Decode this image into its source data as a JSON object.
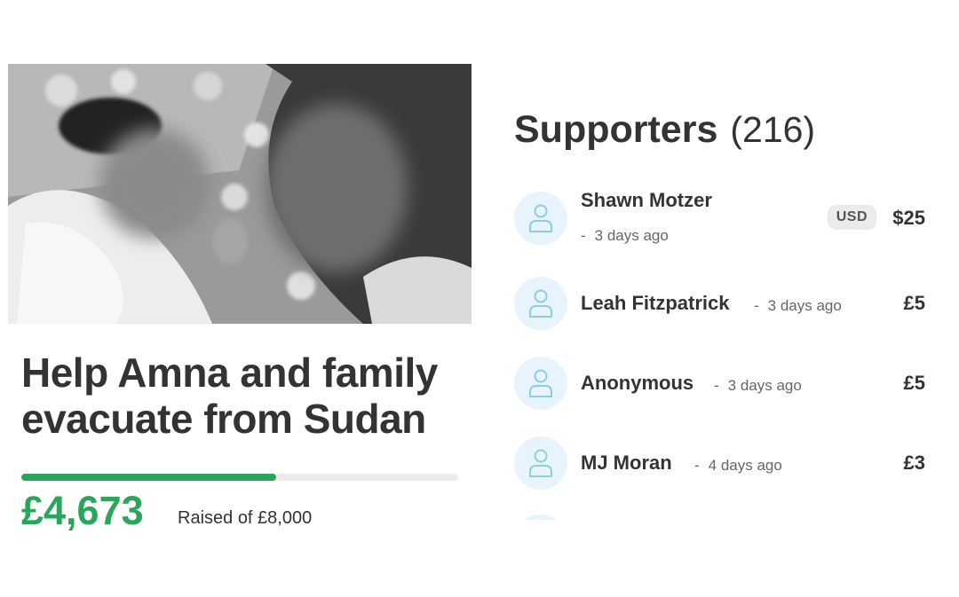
{
  "campaign": {
    "title": "Help Amna and family evacuate from Sudan",
    "raised": "£4,673",
    "raised_of": "Raised of £8,000",
    "progress_fraction": 0.584
  },
  "supporters": {
    "title": "Supporters",
    "count": "(216)",
    "items": [
      {
        "name": "Shawn Motzer",
        "dash": "-",
        "time": "3 days ago",
        "currency": "USD",
        "amount": "$25"
      },
      {
        "name": "Leah Fitzpatrick",
        "dash": "-",
        "time": "3 days ago",
        "amount": "£5"
      },
      {
        "name": "Anonymous",
        "dash": "-",
        "time": "3 days ago",
        "amount": "£5"
      },
      {
        "name": "MJ Moran",
        "dash": "-",
        "time": "4 days ago",
        "amount": "£3"
      }
    ]
  },
  "icons": {
    "avatar": "user-outline-icon"
  },
  "colors": {
    "accent": "#2aa55b",
    "avatar_bg": "#e8f4fb",
    "avatar_icon": "#8fcbe6",
    "text": "#333333"
  }
}
